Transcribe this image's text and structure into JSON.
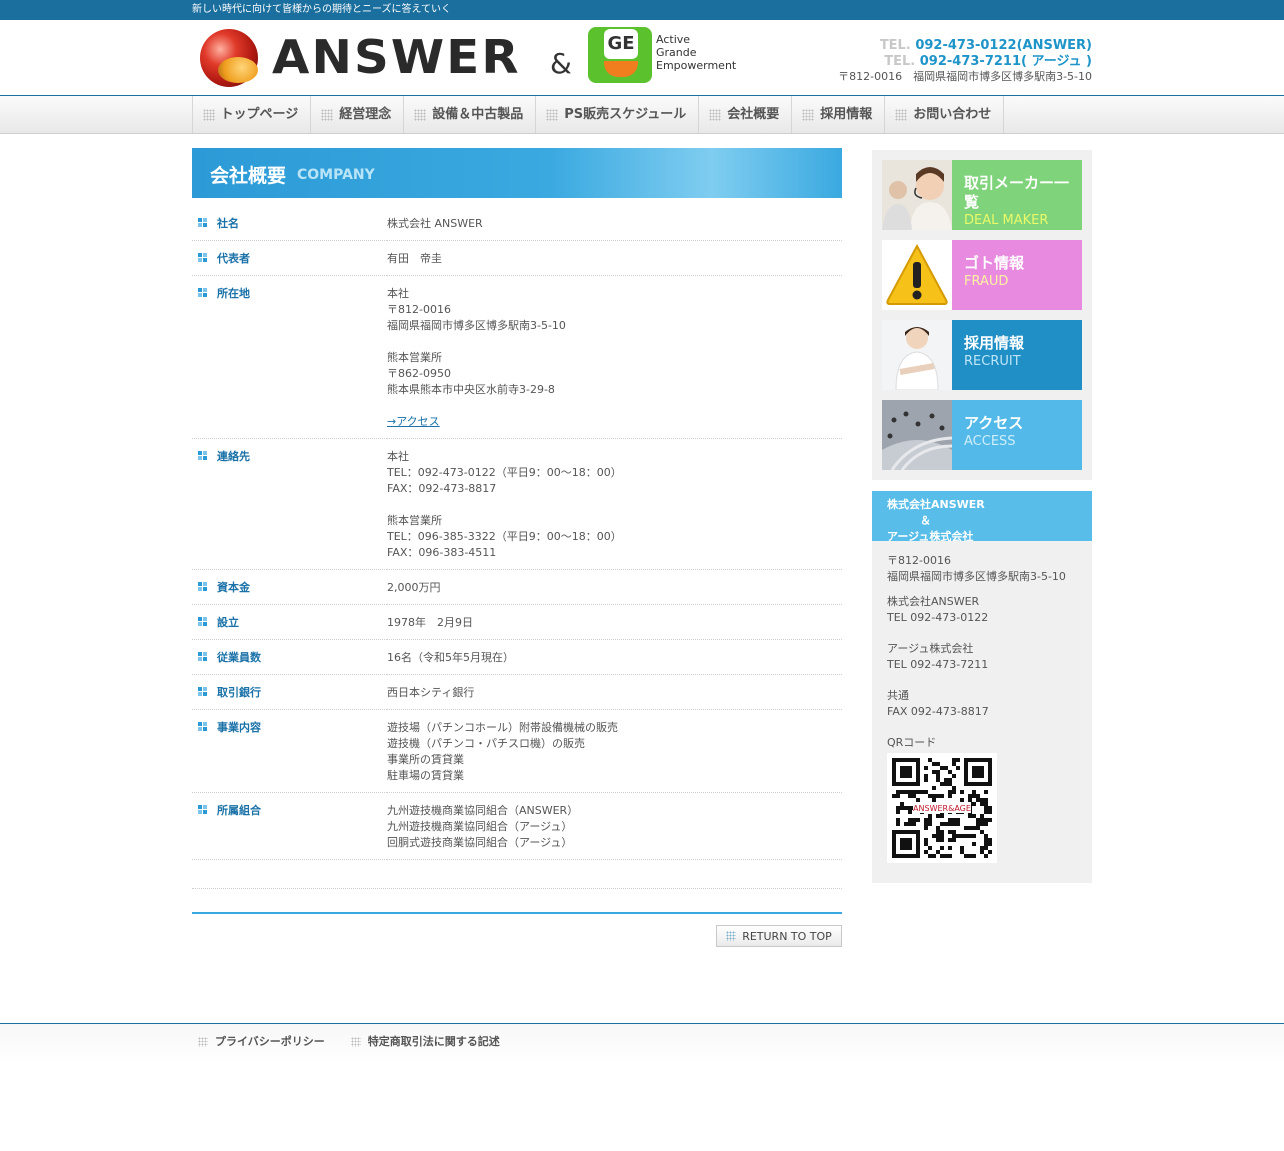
{
  "topbar": {
    "tagline": "新しい時代に向けて皆様からの期待とニーズに答えていく"
  },
  "header": {
    "logo_text": "ANSWER",
    "ampersand": "&",
    "ge_letters": "GE",
    "ge_words": [
      "Active",
      "Grande",
      "Empowerment"
    ],
    "tel_label": "TEL.",
    "tel1": "092-473-0122(ANSWER)",
    "tel2": "092-473-7211( アージュ )",
    "address": "〒812-0016　福岡県福岡市博多区博多駅南3-5-10"
  },
  "nav": [
    "トップページ",
    "経営理念",
    "設備＆中古製品",
    "PS販売スケジュール",
    "会社概要",
    "採用情報",
    "お問い合わせ"
  ],
  "page": {
    "title": "会社概要",
    "subtitle": "COMPANY"
  },
  "company_table": [
    {
      "label": "社名",
      "lines": [
        "株式会社 ANSWER"
      ]
    },
    {
      "label": "代表者",
      "lines": [
        "有田　帝圭"
      ]
    },
    {
      "label": "所在地",
      "lines": [
        "本社",
        "〒812-0016",
        "福岡県福岡市博多区博多駅南3-5-10",
        "",
        "熊本営業所",
        "〒862-0950",
        "熊本県熊本市中央区水前寺3-29-8",
        ""
      ],
      "link": "→アクセス"
    },
    {
      "label": "連絡先",
      "lines": [
        "本社",
        "TEL：092-473-0122（平日9：00〜18：00）",
        "FAX：092-473-8817",
        "",
        "熊本営業所",
        "TEL：096-385-3322（平日9：00〜18：00）",
        "FAX：096-383-4511"
      ]
    },
    {
      "label": "資本金",
      "lines": [
        "2,000万円"
      ]
    },
    {
      "label": "設立",
      "lines": [
        "1978年　2月9日"
      ]
    },
    {
      "label": "従業員数",
      "lines": [
        "16名（令和5年5月現在）"
      ]
    },
    {
      "label": "取引銀行",
      "lines": [
        "西日本シティ銀行"
      ]
    },
    {
      "label": "事業内容",
      "lines": [
        "遊技場（パチンコホール）附帯設備機械の販売",
        "遊技機（パチンコ・パチスロ機）の販売",
        "事業所の賃貸業",
        "駐車場の賃貸業"
      ]
    },
    {
      "label": "所属組合",
      "lines": [
        "九州遊技機商業協同組合（ANSWER）",
        "九州遊技機商業協同組合（アージュ）",
        "回胴式遊技商業協同組合（アージュ）"
      ]
    }
  ],
  "return_to_top": "RETURN TO TOP",
  "sidebar": {
    "banners": [
      {
        "jp": "取引メーカー一覧",
        "en": "DEAL MAKER",
        "bg": "#7fd37a",
        "en_color": "#e9f96a",
        "icon": "operator-photo"
      },
      {
        "jp": "ゴト情報",
        "en": "FRAUD",
        "bg": "#e88ae0",
        "en_color": "#fff2a0",
        "icon": "warning-icon"
      },
      {
        "jp": "採用情報",
        "en": "RECRUIT",
        "bg": "#1f8fc6",
        "en_color": "#bfe6f8",
        "icon": "businesswoman-photo"
      },
      {
        "jp": "アクセス",
        "en": "ACCESS",
        "bg": "#52b9e8",
        "en_color": "#cfeefb",
        "icon": "crowd-photo"
      }
    ],
    "company_box": {
      "head": [
        "株式会社ANSWER",
        "　　　＆",
        "アージュ株式会社"
      ],
      "body": [
        [
          "〒812-0016",
          "福岡県福岡市博多区博多駅南3-5-10"
        ],
        [
          "株式会社ANSWER",
          "TEL 092-473-0122"
        ],
        [
          "アージュ株式会社",
          "TEL 092-473-7211"
        ],
        [
          "共通",
          "FAX 092-473-8817"
        ],
        [
          "QRコード"
        ]
      ],
      "qr_label": "ANSWER&AGE"
    }
  },
  "footer": [
    "プライバシーポリシー",
    "特定商取引法に関する記述"
  ]
}
